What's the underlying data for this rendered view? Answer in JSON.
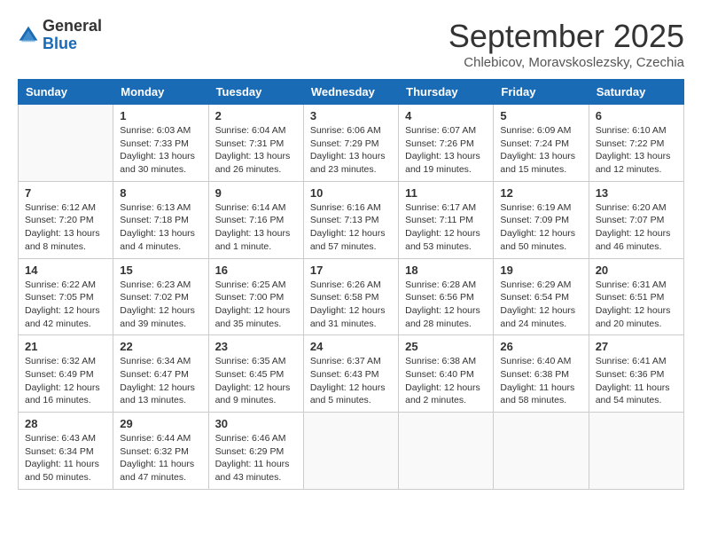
{
  "logo": {
    "general": "General",
    "blue": "Blue"
  },
  "header": {
    "month": "September 2025",
    "location": "Chlebicov, Moravskoslezsky, Czechia"
  },
  "weekdays": [
    "Sunday",
    "Monday",
    "Tuesday",
    "Wednesday",
    "Thursday",
    "Friday",
    "Saturday"
  ],
  "weeks": [
    [
      {
        "day": "",
        "info": ""
      },
      {
        "day": "1",
        "info": "Sunrise: 6:03 AM\nSunset: 7:33 PM\nDaylight: 13 hours\nand 30 minutes."
      },
      {
        "day": "2",
        "info": "Sunrise: 6:04 AM\nSunset: 7:31 PM\nDaylight: 13 hours\nand 26 minutes."
      },
      {
        "day": "3",
        "info": "Sunrise: 6:06 AM\nSunset: 7:29 PM\nDaylight: 13 hours\nand 23 minutes."
      },
      {
        "day": "4",
        "info": "Sunrise: 6:07 AM\nSunset: 7:26 PM\nDaylight: 13 hours\nand 19 minutes."
      },
      {
        "day": "5",
        "info": "Sunrise: 6:09 AM\nSunset: 7:24 PM\nDaylight: 13 hours\nand 15 minutes."
      },
      {
        "day": "6",
        "info": "Sunrise: 6:10 AM\nSunset: 7:22 PM\nDaylight: 13 hours\nand 12 minutes."
      }
    ],
    [
      {
        "day": "7",
        "info": "Sunrise: 6:12 AM\nSunset: 7:20 PM\nDaylight: 13 hours\nand 8 minutes."
      },
      {
        "day": "8",
        "info": "Sunrise: 6:13 AM\nSunset: 7:18 PM\nDaylight: 13 hours\nand 4 minutes."
      },
      {
        "day": "9",
        "info": "Sunrise: 6:14 AM\nSunset: 7:16 PM\nDaylight: 13 hours\nand 1 minute."
      },
      {
        "day": "10",
        "info": "Sunrise: 6:16 AM\nSunset: 7:13 PM\nDaylight: 12 hours\nand 57 minutes."
      },
      {
        "day": "11",
        "info": "Sunrise: 6:17 AM\nSunset: 7:11 PM\nDaylight: 12 hours\nand 53 minutes."
      },
      {
        "day": "12",
        "info": "Sunrise: 6:19 AM\nSunset: 7:09 PM\nDaylight: 12 hours\nand 50 minutes."
      },
      {
        "day": "13",
        "info": "Sunrise: 6:20 AM\nSunset: 7:07 PM\nDaylight: 12 hours\nand 46 minutes."
      }
    ],
    [
      {
        "day": "14",
        "info": "Sunrise: 6:22 AM\nSunset: 7:05 PM\nDaylight: 12 hours\nand 42 minutes."
      },
      {
        "day": "15",
        "info": "Sunrise: 6:23 AM\nSunset: 7:02 PM\nDaylight: 12 hours\nand 39 minutes."
      },
      {
        "day": "16",
        "info": "Sunrise: 6:25 AM\nSunset: 7:00 PM\nDaylight: 12 hours\nand 35 minutes."
      },
      {
        "day": "17",
        "info": "Sunrise: 6:26 AM\nSunset: 6:58 PM\nDaylight: 12 hours\nand 31 minutes."
      },
      {
        "day": "18",
        "info": "Sunrise: 6:28 AM\nSunset: 6:56 PM\nDaylight: 12 hours\nand 28 minutes."
      },
      {
        "day": "19",
        "info": "Sunrise: 6:29 AM\nSunset: 6:54 PM\nDaylight: 12 hours\nand 24 minutes."
      },
      {
        "day": "20",
        "info": "Sunrise: 6:31 AM\nSunset: 6:51 PM\nDaylight: 12 hours\nand 20 minutes."
      }
    ],
    [
      {
        "day": "21",
        "info": "Sunrise: 6:32 AM\nSunset: 6:49 PM\nDaylight: 12 hours\nand 16 minutes."
      },
      {
        "day": "22",
        "info": "Sunrise: 6:34 AM\nSunset: 6:47 PM\nDaylight: 12 hours\nand 13 minutes."
      },
      {
        "day": "23",
        "info": "Sunrise: 6:35 AM\nSunset: 6:45 PM\nDaylight: 12 hours\nand 9 minutes."
      },
      {
        "day": "24",
        "info": "Sunrise: 6:37 AM\nSunset: 6:43 PM\nDaylight: 12 hours\nand 5 minutes."
      },
      {
        "day": "25",
        "info": "Sunrise: 6:38 AM\nSunset: 6:40 PM\nDaylight: 12 hours\nand 2 minutes."
      },
      {
        "day": "26",
        "info": "Sunrise: 6:40 AM\nSunset: 6:38 PM\nDaylight: 11 hours\nand 58 minutes."
      },
      {
        "day": "27",
        "info": "Sunrise: 6:41 AM\nSunset: 6:36 PM\nDaylight: 11 hours\nand 54 minutes."
      }
    ],
    [
      {
        "day": "28",
        "info": "Sunrise: 6:43 AM\nSunset: 6:34 PM\nDaylight: 11 hours\nand 50 minutes."
      },
      {
        "day": "29",
        "info": "Sunrise: 6:44 AM\nSunset: 6:32 PM\nDaylight: 11 hours\nand 47 minutes."
      },
      {
        "day": "30",
        "info": "Sunrise: 6:46 AM\nSunset: 6:29 PM\nDaylight: 11 hours\nand 43 minutes."
      },
      {
        "day": "",
        "info": ""
      },
      {
        "day": "",
        "info": ""
      },
      {
        "day": "",
        "info": ""
      },
      {
        "day": "",
        "info": ""
      }
    ]
  ]
}
